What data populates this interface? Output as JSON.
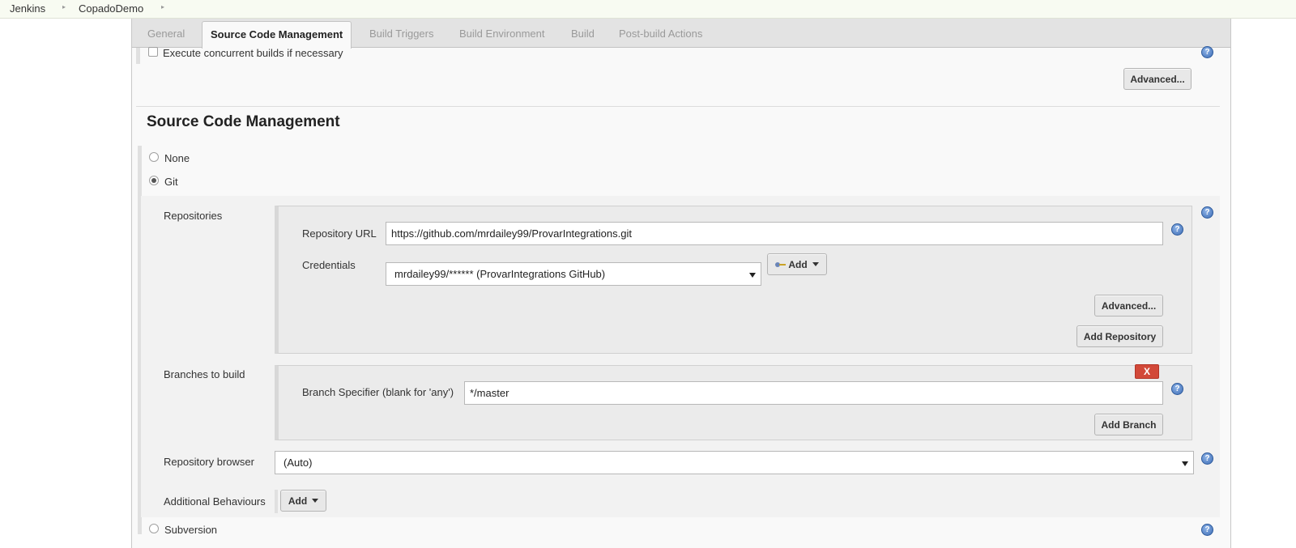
{
  "breadcrumb": {
    "items": [
      "Jenkins",
      "CopadoDemo"
    ]
  },
  "tabs": [
    {
      "label": "General"
    },
    {
      "label": "Source Code Management"
    },
    {
      "label": "Build Triggers"
    },
    {
      "label": "Build Environment"
    },
    {
      "label": "Build"
    },
    {
      "label": "Post-build Actions"
    }
  ],
  "general": {
    "concurrent_label": "Execute concurrent builds if necessary",
    "advanced_label": "Advanced..."
  },
  "scm": {
    "title": "Source Code Management",
    "options": {
      "none": "None",
      "git": "Git",
      "subversion": "Subversion"
    },
    "selected": "git",
    "repositories": {
      "label": "Repositories",
      "url_label": "Repository URL",
      "url_value": "https://github.com/mrdailey99/ProvarIntegrations.git",
      "credentials_label": "Credentials",
      "credentials_value": "mrdailey99/****** (ProvarIntegrations GitHub)",
      "add_label": "Add",
      "advanced_label": "Advanced...",
      "add_repository_label": "Add Repository"
    },
    "branches": {
      "label": "Branches to build",
      "delete_label": "X",
      "specifier_label": "Branch Specifier (blank for 'any')",
      "specifier_value": "*/master",
      "add_branch_label": "Add Branch"
    },
    "repository_browser": {
      "label": "Repository browser",
      "value": "(Auto)"
    },
    "additional_behaviours": {
      "label": "Additional Behaviours",
      "add_label": "Add"
    }
  },
  "icons": {
    "help": "help-icon",
    "help_glyph": "?",
    "breadcrumb_separator": "chevron-right-icon",
    "credentials_add": "key-icon"
  },
  "colors": {
    "breadcrumb_bg": "#f8fbf2",
    "delete_button": "#d24939",
    "help_icon": "#3d6db5"
  }
}
